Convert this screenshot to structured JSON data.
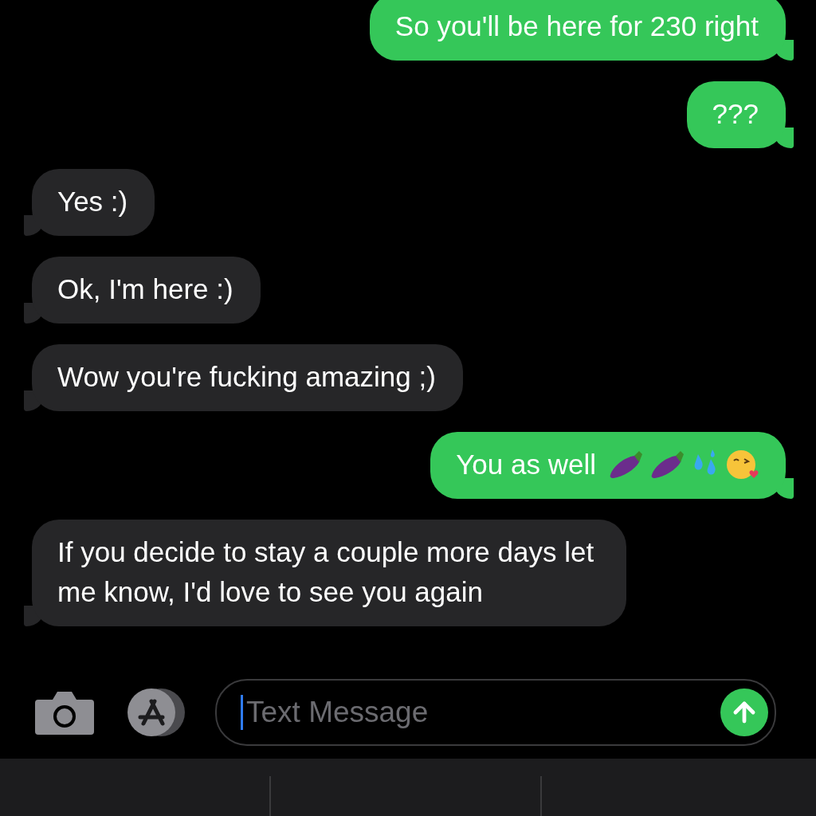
{
  "messages": [
    {
      "kind": "sent",
      "text": "So you'll be here for 230 right"
    },
    {
      "kind": "sent",
      "text": "???"
    },
    {
      "kind": "received",
      "text": "Yes :)"
    },
    {
      "kind": "received",
      "text": "Ok, I'm here :)"
    },
    {
      "kind": "received",
      "text": "Wow you're fucking amazing ;)"
    },
    {
      "kind": "sent-emoji",
      "text": "You as well"
    },
    {
      "kind": "received",
      "text": "If you decide to stay a couple more days let me know, I'd love to see you again"
    }
  ],
  "composer": {
    "placeholder": "Text Message"
  }
}
